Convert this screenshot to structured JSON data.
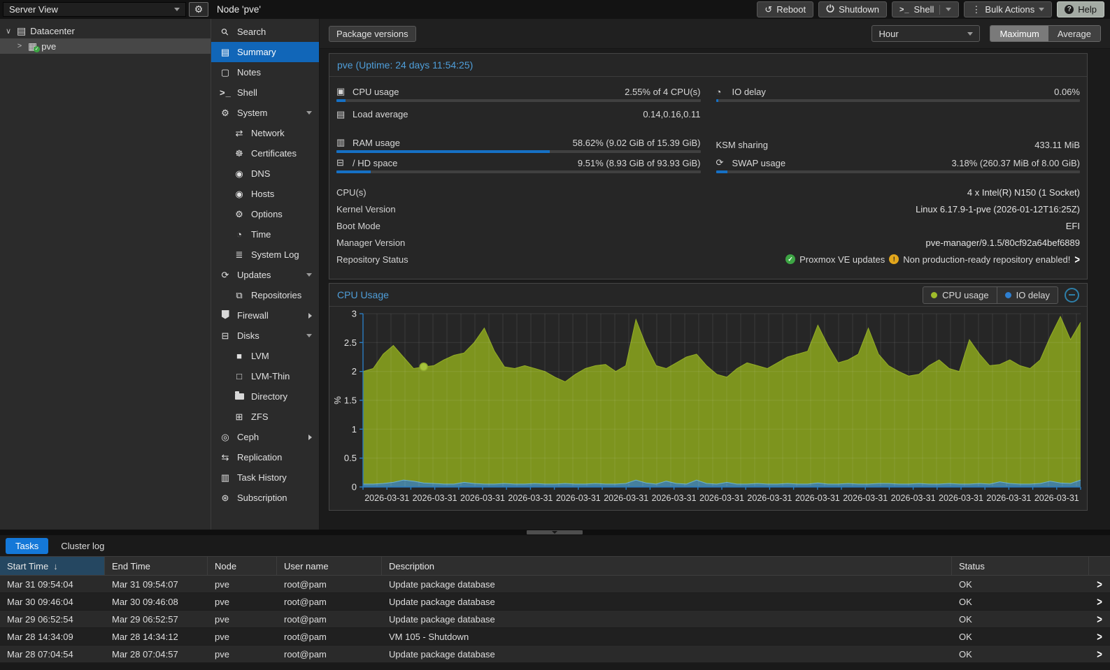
{
  "colors": {
    "selection_blue": "#1166b8",
    "tab_active_blue": "#1478d8",
    "progress_blue": "#1670c4",
    "title_blue": "#4f9ed9",
    "ok_green": "#3da544",
    "warn_yellow": "#e2a61c",
    "axis_blue": "#2b7cc0",
    "cpu_area_olive": "#7d941e",
    "io_area_blue": "#45809e"
  },
  "topbar": {
    "server_view_label": "Server View",
    "node_title": "Node 'pve'",
    "reboot": "Reboot",
    "shutdown": "Shutdown",
    "shell": "Shell",
    "bulk_actions": "Bulk Actions",
    "help": "Help"
  },
  "tree": {
    "datacenter": "Datacenter",
    "node": "pve"
  },
  "menu": {
    "items": [
      {
        "label": "Search",
        "icon": "search-icon",
        "level": 0
      },
      {
        "label": "Summary",
        "icon": "book-icon",
        "level": 0,
        "selected": true
      },
      {
        "label": "Notes",
        "icon": "note-icon",
        "level": 0
      },
      {
        "label": "Shell",
        "icon": "terminal-icon",
        "level": 0
      },
      {
        "label": "System",
        "icon": "gears-icon",
        "level": 0,
        "expand": "down"
      },
      {
        "label": "Network",
        "icon": "network-icon",
        "level": 1
      },
      {
        "label": "Certificates",
        "icon": "certificate-icon",
        "level": 1
      },
      {
        "label": "DNS",
        "icon": "globe-icon",
        "level": 1
      },
      {
        "label": "Hosts",
        "icon": "globe-icon",
        "level": 1
      },
      {
        "label": "Options",
        "icon": "gear-icon",
        "level": 1
      },
      {
        "label": "Time",
        "icon": "clock-icon",
        "level": 1
      },
      {
        "label": "System Log",
        "icon": "list-icon",
        "level": 1
      },
      {
        "label": "Updates",
        "icon": "refresh-icon",
        "level": 0,
        "expand": "down"
      },
      {
        "label": "Repositories",
        "icon": "copy-icon",
        "level": 1
      },
      {
        "label": "Firewall",
        "icon": "shield-icon",
        "level": 0,
        "expand": "right"
      },
      {
        "label": "Disks",
        "icon": "hdd-icon",
        "level": 0,
        "expand": "down"
      },
      {
        "label": "LVM",
        "icon": "square-filled-icon",
        "level": 1
      },
      {
        "label": "LVM-Thin",
        "icon": "square-outline-icon",
        "level": 1
      },
      {
        "label": "Directory",
        "icon": "folder-icon",
        "level": 1
      },
      {
        "label": "ZFS",
        "icon": "grid-icon",
        "level": 1
      },
      {
        "label": "Ceph",
        "icon": "ceph-icon",
        "level": 0,
        "expand": "right"
      },
      {
        "label": "Replication",
        "icon": "replication-icon",
        "level": 0
      },
      {
        "label": "Task History",
        "icon": "task-list-icon",
        "level": 0
      },
      {
        "label": "Subscription",
        "icon": "lifering-icon",
        "level": 0
      }
    ]
  },
  "toolbar": {
    "package_versions": "Package versions",
    "timeframe": "Hour",
    "maximum": "Maximum",
    "average": "Average"
  },
  "summary": {
    "title": "pve (Uptime: 24 days 11:54:25)",
    "gauges": {
      "cpu": {
        "label": "CPU usage",
        "icon": "cpu-icon",
        "value": "2.55% of 4 CPU(s)",
        "pct": 2.55
      },
      "io": {
        "label": "IO delay",
        "icon": "clock-icon",
        "value": "0.06%",
        "pct": 0.06
      },
      "load": {
        "label": "Load average",
        "icon": "server-icon",
        "value": "0.14,0.16,0.11"
      },
      "ram": {
        "label": "RAM usage",
        "icon": "memory-icon",
        "value": "58.62% (9.02 GiB of 15.39 GiB)",
        "pct": 58.62
      },
      "ksm": {
        "label": "KSM sharing",
        "value": "433.11 MiB"
      },
      "hd": {
        "label": "/ HD space",
        "icon": "hdd-icon",
        "value": "9.51% (8.93 GiB of 93.93 GiB)",
        "pct": 9.51
      },
      "swap": {
        "label": "SWAP usage",
        "icon": "swap-icon",
        "value": "3.18% (260.37 MiB of 8.00 GiB)",
        "pct": 3.18
      }
    },
    "info": [
      {
        "label": "CPU(s)",
        "value": "4 x Intel(R) N150 (1 Socket)"
      },
      {
        "label": "Kernel Version",
        "value": "Linux 6.17.9-1-pve (2026-01-12T16:25Z)"
      },
      {
        "label": "Boot Mode",
        "value": "EFI"
      },
      {
        "label": "Manager Version",
        "value": "pve-manager/9.1.5/80cf92a64bef6889"
      }
    ],
    "repo": {
      "label": "Repository Status",
      "ok_text": "Proxmox VE updates",
      "warning_text": "Non production-ready repository enabled!"
    }
  },
  "chart_data": {
    "type": "area",
    "title": "CPU Usage",
    "ylabel": "%",
    "ylim": [
      0,
      3
    ],
    "yticks": [
      0,
      0.5,
      1,
      1.5,
      2,
      2.5,
      3
    ],
    "grid": true,
    "legend_position": "top-right",
    "x_labels": [
      "2026-03-31",
      "2026-03-31",
      "2026-03-31",
      "2026-03-31",
      "2026-03-31",
      "2026-03-31",
      "2026-03-31",
      "2026-03-31",
      "2026-03-31",
      "2026-03-31",
      "2026-03-31",
      "2026-03-31",
      "2026-03-31",
      "2026-03-31",
      "2026-03-31"
    ],
    "legend": [
      {
        "name": "CPU usage",
        "color": "#9fbc2b"
      },
      {
        "name": "IO delay",
        "color": "#2e7fd0"
      }
    ],
    "series": [
      {
        "name": "CPU usage",
        "fill": "#7d941e",
        "stroke": "#93ad25",
        "values": [
          2.0,
          2.05,
          2.3,
          2.45,
          2.25,
          2.05,
          2.08,
          2.1,
          2.2,
          2.28,
          2.32,
          2.5,
          2.75,
          2.35,
          2.08,
          2.05,
          2.1,
          2.05,
          2.0,
          1.9,
          1.82,
          1.95,
          2.05,
          2.1,
          2.12,
          2.0,
          2.1,
          2.9,
          2.45,
          2.1,
          2.05,
          2.15,
          2.25,
          2.3,
          2.1,
          1.95,
          1.9,
          2.05,
          2.15,
          2.1,
          2.05,
          2.15,
          2.25,
          2.3,
          2.35,
          2.8,
          2.45,
          2.15,
          2.2,
          2.3,
          2.75,
          2.3,
          2.1,
          2.0,
          1.92,
          1.95,
          2.1,
          2.2,
          2.05,
          2.0,
          2.55,
          2.3,
          2.1,
          2.12,
          2.2,
          2.1,
          2.05,
          2.2,
          2.6,
          2.95,
          2.55,
          2.85
        ]
      },
      {
        "name": "IO delay",
        "fill": "#45809e",
        "stroke": "#6cb1d1",
        "values": [
          0.05,
          0.05,
          0.06,
          0.08,
          0.12,
          0.1,
          0.07,
          0.06,
          0.05,
          0.05,
          0.08,
          0.06,
          0.05,
          0.05,
          0.06,
          0.05,
          0.05,
          0.06,
          0.05,
          0.05,
          0.06,
          0.05,
          0.05,
          0.06,
          0.05,
          0.05,
          0.06,
          0.12,
          0.07,
          0.05,
          0.1,
          0.06,
          0.05,
          0.12,
          0.06,
          0.05,
          0.08,
          0.05,
          0.05,
          0.06,
          0.05,
          0.05,
          0.06,
          0.05,
          0.05,
          0.07,
          0.05,
          0.05,
          0.06,
          0.05,
          0.05,
          0.06,
          0.06,
          0.05,
          0.05,
          0.06,
          0.05,
          0.05,
          0.06,
          0.05,
          0.05,
          0.06,
          0.05,
          0.09,
          0.06,
          0.05,
          0.05,
          0.06,
          0.1,
          0.07,
          0.06,
          0.12
        ]
      }
    ],
    "marker": {
      "series": 0,
      "index": 6,
      "value": 2.08
    }
  },
  "tasks": {
    "tabs": [
      {
        "label": "Tasks",
        "active": true
      },
      {
        "label": "Cluster log",
        "active": false
      }
    ],
    "columns": [
      "Start Time",
      "End Time",
      "Node",
      "User name",
      "Description",
      "Status"
    ],
    "sort_column": "Start Time",
    "sort_direction": "desc",
    "rows": [
      {
        "start": "Mar 31 09:54:04",
        "end": "Mar 31 09:54:07",
        "node": "pve",
        "user": "root@pam",
        "description": "Update package database",
        "status": "OK"
      },
      {
        "start": "Mar 30 09:46:04",
        "end": "Mar 30 09:46:08",
        "node": "pve",
        "user": "root@pam",
        "description": "Update package database",
        "status": "OK"
      },
      {
        "start": "Mar 29 06:52:54",
        "end": "Mar 29 06:52:57",
        "node": "pve",
        "user": "root@pam",
        "description": "Update package database",
        "status": "OK"
      },
      {
        "start": "Mar 28 14:34:09",
        "end": "Mar 28 14:34:12",
        "node": "pve",
        "user": "root@pam",
        "description": "VM 105 - Shutdown",
        "status": "OK"
      },
      {
        "start": "Mar 28 07:04:54",
        "end": "Mar 28 07:04:57",
        "node": "pve",
        "user": "root@pam",
        "description": "Update package database",
        "status": "OK"
      }
    ]
  }
}
